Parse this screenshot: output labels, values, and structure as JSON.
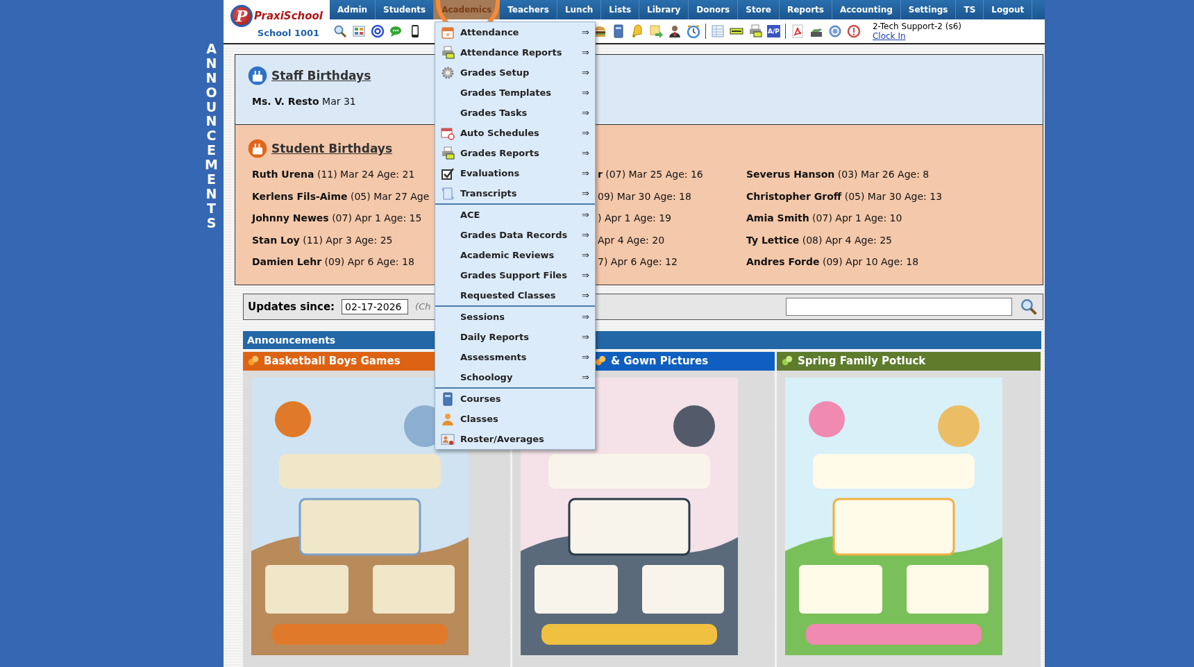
{
  "logo": {
    "mark": "P",
    "name": "PraxiSchool",
    "school": "School 1001"
  },
  "nav": [
    {
      "label": "Admin",
      "selected": false
    },
    {
      "label": "Students",
      "selected": false
    },
    {
      "label": "Academics",
      "selected": true
    },
    {
      "label": "Teachers",
      "selected": false
    },
    {
      "label": "Lunch",
      "selected": false
    },
    {
      "label": "Lists",
      "selected": false
    },
    {
      "label": "Library",
      "selected": false
    },
    {
      "label": "Donors",
      "selected": false
    },
    {
      "label": "Store",
      "selected": false
    },
    {
      "label": "Reports",
      "selected": false
    },
    {
      "label": "Accounting",
      "selected": false
    },
    {
      "label": "Settings",
      "selected": false
    },
    {
      "label": "TS",
      "selected": false
    },
    {
      "label": "Logout",
      "selected": false
    }
  ],
  "toolbar": {
    "ap_label": "A/P"
  },
  "user": {
    "name": "2-Tech Support-2 (s6)",
    "link": "Clock In"
  },
  "side_label": "ANNOUNCEMENTS",
  "staff_birthdays": {
    "title": "Staff Birthdays",
    "entries": [
      "**Ms. V. Resto** Mar 31"
    ]
  },
  "student_birthdays": {
    "title": "Student Birthdays",
    "columns": [
      [
        "**Ruth Urena** (11) Mar 24 Age: 21",
        "**Kerlens Fils-Aime** (05) Mar 27 Age",
        "**Johnny Newes** (07) Apr 1 Age: 15",
        "**Stan Loy** (11) Apr 3 Age: 25",
        "**Damien Lehr** (09) Apr 6 Age: 18"
      ],
      [
        "**r** (07) Mar 25 Age: 16",
        "09) Mar 30 Age: 18",
        ") Apr 1 Age: 19",
        "Apr 4 Age: 20",
        "7) Apr 6 Age: 12"
      ],
      [
        "**Severus Hanson** (03) Mar 26 Age: 8",
        "**Christopher Groff** (05) Mar 30 Age: 13",
        "**Amia Smith** (07) Apr 1 Age: 10",
        "**Ty Lettice** (08) Apr 4 Age: 25",
        "**Andres Forde** (09) Apr 10 Age: 18"
      ]
    ]
  },
  "updates": {
    "label": "Updates since:",
    "date": "02-17-2026",
    "note": "(Ch"
  },
  "announcements": {
    "title": "Announcements",
    "items": [
      {
        "title": "Basketball Boys Games",
        "color": "#dd6314"
      },
      {
        "title": "& Gown Pictures",
        "color": "#0e5fbf"
      },
      {
        "title": "Spring Family Potluck",
        "color": "#5e7c2c"
      }
    ]
  },
  "menu": {
    "groups": [
      [
        {
          "label": "Attendance",
          "arrow": "⇒"
        },
        {
          "label": "Attendance Reports",
          "arrow": "⇒"
        },
        {
          "label": "Grades Setup",
          "arrow": "⇒"
        },
        {
          "label": "Grades Templates",
          "arrow": "⇒"
        },
        {
          "label": "Grades Tasks",
          "arrow": "⇒"
        },
        {
          "label": "Auto Schedules",
          "arrow": "⇒"
        },
        {
          "label": "Grades Reports",
          "arrow": "⇒"
        },
        {
          "label": "Evaluations",
          "arrow": "⇒"
        },
        {
          "label": "Transcripts",
          "arrow": "⇒"
        }
      ],
      [
        {
          "label": "ACE",
          "arrow": "⇒"
        },
        {
          "label": "Grades Data Records",
          "arrow": "⇒"
        },
        {
          "label": "Academic Reviews",
          "arrow": "⇒"
        },
        {
          "label": "Grades Support Files",
          "arrow": "⇒"
        },
        {
          "label": "Requested Classes",
          "arrow": "⇒"
        }
      ],
      [
        {
          "label": "Sessions",
          "arrow": "⇒"
        },
        {
          "label": "Daily Reports",
          "arrow": "⇒"
        },
        {
          "label": "Assessments",
          "arrow": "⇒"
        },
        {
          "label": "Schoology",
          "arrow": "⇒"
        }
      ],
      [
        {
          "label": "Courses"
        },
        {
          "label": "Classes"
        },
        {
          "label": "Roster/Averages"
        }
      ]
    ]
  }
}
